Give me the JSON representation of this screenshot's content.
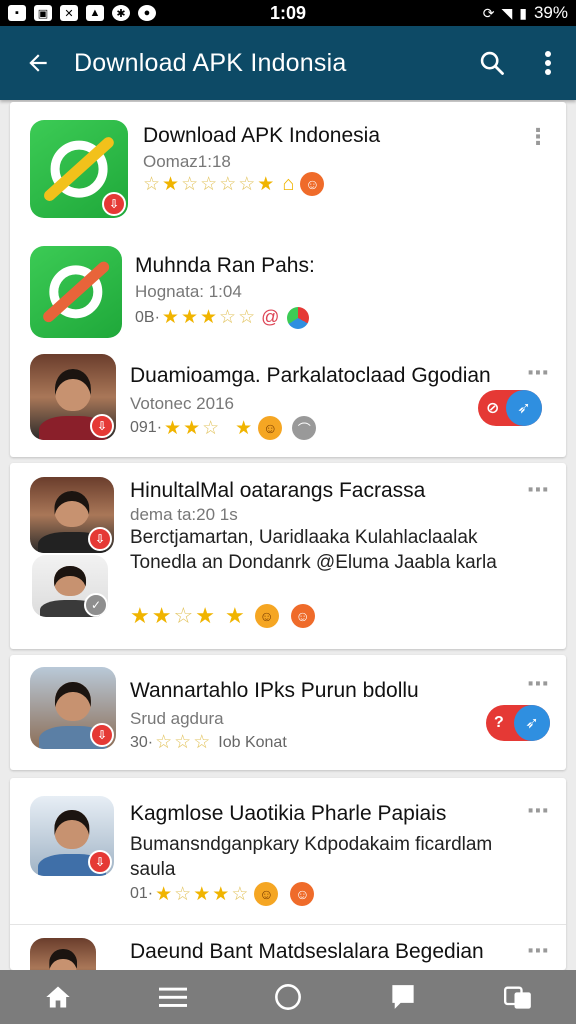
{
  "status_bar": {
    "time": "1:09",
    "battery": "39%",
    "left_icons": [
      "sim-icon",
      "gallery-icon",
      "x-icon",
      "photo-icon",
      "bug-icon",
      "chat-icon"
    ]
  },
  "appbar": {
    "title": "Download APK Indonsia",
    "back_icon": "arrow-left-icon",
    "search_icon": "search-icon",
    "more_icon": "more-vert-icon"
  },
  "items": [
    {
      "title": "Download APK Indonesia",
      "subtitle": "Oomaz1:18",
      "meta_prefix": "",
      "icon": "app-icon-green",
      "accent": "#f2c11b"
    },
    {
      "title": "Muhnda Ran Pahs:",
      "subtitle": "Hognata: 1:04",
      "meta_prefix": "0B·",
      "icon": "app-icon-green",
      "accent": "#e8643a"
    },
    {
      "title": "Duamioamga. Parkalatoclaad Ggodian",
      "subtitle": "Votonec 2016",
      "meta_prefix": "091·",
      "icon": "person-avatar"
    },
    {
      "title": "HinultalMal oatarangs Facrassa",
      "subtitle": "dema ta:20 1s",
      "description": "Berctjamartan, Uaridlaaka Kulahlaclaalak Tonedla an Dondanrk @Eluma Jaabla karla",
      "icon": "person-avatar"
    },
    {
      "title": "Wannartahlo IPks Purun bdollu",
      "subtitle": "Srud agdura",
      "meta_prefix": "30·",
      "meta_suffix": "Iob Konat",
      "icon": "person-avatar"
    },
    {
      "title": "Kagmlose Uaotikia Pharle Papiais",
      "description": "Bumansndganpkary Kdpodakaim ficardlam saula",
      "meta_prefix": "01·",
      "icon": "person-avatar"
    },
    {
      "title": "Daeund Bant Matdseslalara Begedian",
      "icon": "person-avatar"
    }
  ],
  "bottom_nav": [
    "home-icon",
    "menu-icon",
    "circle-icon",
    "chat-bubble-icon",
    "translate-icon"
  ],
  "colors": {
    "appbar": "#0d4a66",
    "statusbar": "#000000",
    "bottomnav": "#7c7c7c",
    "accent_red": "#e53935",
    "accent_blue": "#2f8fe0",
    "star": "#f0b400",
    "app_green": "#2fbf4a"
  }
}
